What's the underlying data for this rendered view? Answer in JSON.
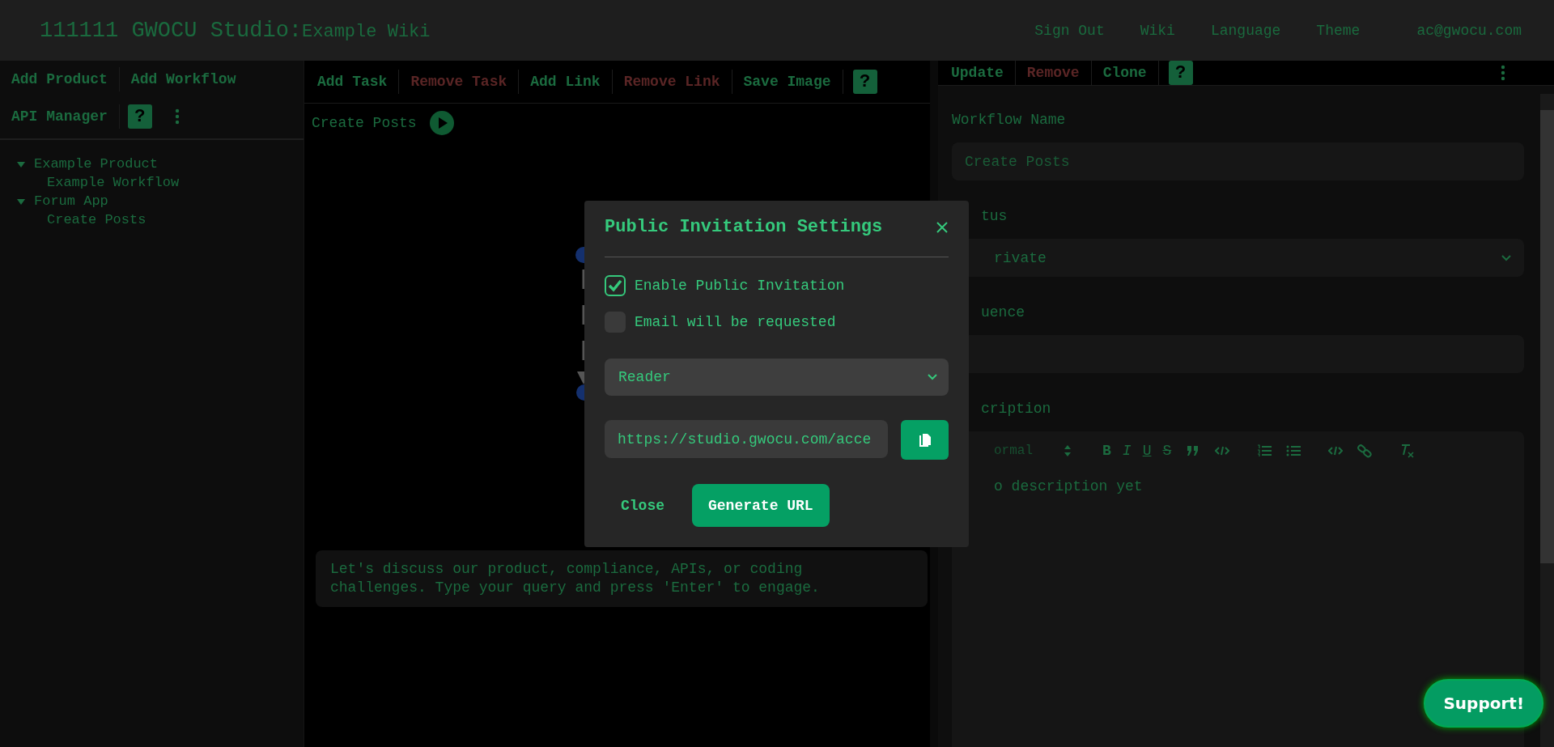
{
  "header": {
    "title": "111111 GWOCU Studio:",
    "subtitle": "Example Wiki",
    "nav": [
      "Sign Out",
      "Wiki",
      "Language",
      "Theme",
      "ac@gwocu.com"
    ]
  },
  "left_toolbar": {
    "buttons": [
      {
        "label": "Add Product"
      },
      {
        "label": "Add Workflow"
      },
      {
        "label": "API Manager"
      }
    ],
    "help": "?"
  },
  "tree": [
    {
      "label": "Example Product",
      "expanded": true,
      "children": [
        {
          "label": "Example Workflow"
        }
      ]
    },
    {
      "label": "Forum App",
      "expanded": true,
      "children": [
        {
          "label": "Create Posts"
        }
      ]
    }
  ],
  "canvas_toolbar": {
    "buttons": [
      {
        "label": "Add Task",
        "kind": "action"
      },
      {
        "label": "Remove Task",
        "kind": "danger"
      },
      {
        "label": "Add Link",
        "kind": "action"
      },
      {
        "label": "Remove Link",
        "kind": "danger"
      },
      {
        "label": "Save Image",
        "kind": "action"
      }
    ],
    "help": "?"
  },
  "workflow": {
    "name": "Create Posts"
  },
  "chat": {
    "message": "Let's discuss our product, compliance, APIs, or coding challenges. Type your query and press 'Enter' to engage."
  },
  "detail_toolbar": {
    "buttons": [
      {
        "label": "Update",
        "kind": "action"
      },
      {
        "label": "Remove",
        "kind": "danger"
      },
      {
        "label": "Clone",
        "kind": "action"
      }
    ],
    "help": "?"
  },
  "form": {
    "name_label": "Workflow Name",
    "name_placeholder": "Create Posts",
    "status_label": "tus",
    "status_value": "rivate",
    "sequence_label": "uence",
    "description_label": "cription",
    "editor": {
      "format": "ormal",
      "marks": [
        "B",
        "I",
        "U",
        "S"
      ],
      "content": "o description yet"
    }
  },
  "modal": {
    "title": "Public Invitation Settings",
    "options": [
      {
        "label": "Enable Public Invitation",
        "checked": true
      },
      {
        "label": "Email will be requested",
        "checked": false
      }
    ],
    "role": "Reader",
    "url": "https://studio.gwocu.com/acce",
    "close": "Close",
    "generate": "Generate URL"
  },
  "support": "Support!"
}
